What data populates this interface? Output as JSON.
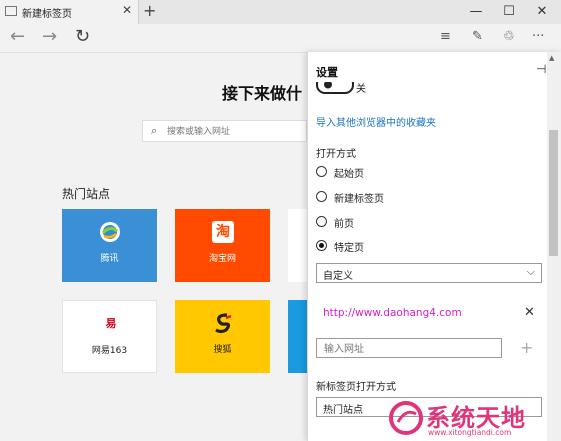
{
  "tab": {
    "title": "新建标签页",
    "close": "✕",
    "new": "+"
  },
  "window": {
    "minimize": "—",
    "maximize": "☐",
    "close": "✕"
  },
  "nav": {
    "back": "←",
    "forward": "→",
    "refresh": "↻"
  },
  "toolbar": {
    "hub": "≡",
    "note": "✎",
    "share": "♲",
    "more": "···"
  },
  "page": {
    "headline": "接下来做什",
    "search_placeholder": "搜索或输入网址",
    "hot_sites_title": "热门站点",
    "tiles": [
      {
        "label": "腾讯",
        "bg": "#3b8fd4",
        "fg": "#ffffff"
      },
      {
        "label": "淘宝网",
        "bg": "#ff4a00",
        "fg": "#ffffff"
      },
      {
        "label": "网易163",
        "bg": "#ffffff",
        "fg": "#222222"
      },
      {
        "label": "搜狐",
        "bg": "#ffc800",
        "fg": "#222222"
      }
    ]
  },
  "settings": {
    "title": "设置",
    "pin": "⊣",
    "toggle_label": "关",
    "import_link": "导入其他浏览器中的收藏夹",
    "open_with_label": "打开方式",
    "open_options": [
      {
        "label": "起始页",
        "selected": false
      },
      {
        "label": "新建标签页",
        "selected": false
      },
      {
        "label": "前页",
        "selected": false
      },
      {
        "label": "特定页",
        "selected": true
      }
    ],
    "custom_select": "自定义",
    "url": "http://www.daohang4.com",
    "url_input_placeholder": "输入网址",
    "add": "+",
    "newtab_label": "新标签页打开方式",
    "newtab_select": "热门站点"
  },
  "watermark": {
    "text": "系统天地",
    "url": "www.xitongtiandi.com"
  },
  "colors": {
    "accent_link": "#1a73c9",
    "url_text": "#d41ec8",
    "watermark": "#e0357a"
  }
}
